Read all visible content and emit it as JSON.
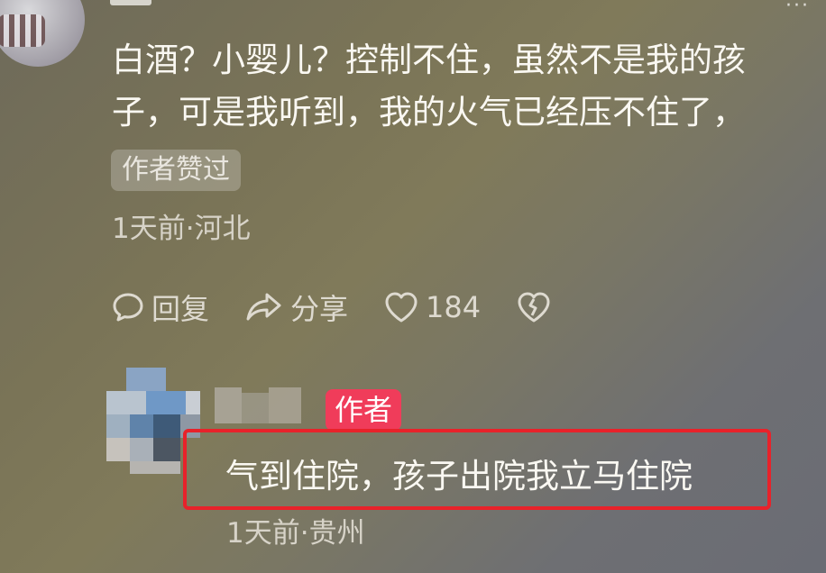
{
  "comment": {
    "text": "白酒？小婴儿？控制不住，虽然不是我的孩子，可是我听到，我的火气已经压不住了，",
    "liked_badge": "作者赞过",
    "meta": "1天前·河北",
    "actions": {
      "reply_label": "回复",
      "share_label": "分享",
      "like_count": "184"
    }
  },
  "reply": {
    "author_tag": "作者",
    "text": "气到住院，孩子出院我立马住院",
    "meta": "1天前·贵州"
  },
  "icons": {
    "reply": "speech-bubble-icon",
    "share": "share-arrow-icon",
    "like": "heart-icon",
    "dislike": "broken-heart-icon",
    "more": "more-dots-icon"
  },
  "colors": {
    "author_tag": "#f03c5a",
    "highlight_border": "#e8222a"
  }
}
